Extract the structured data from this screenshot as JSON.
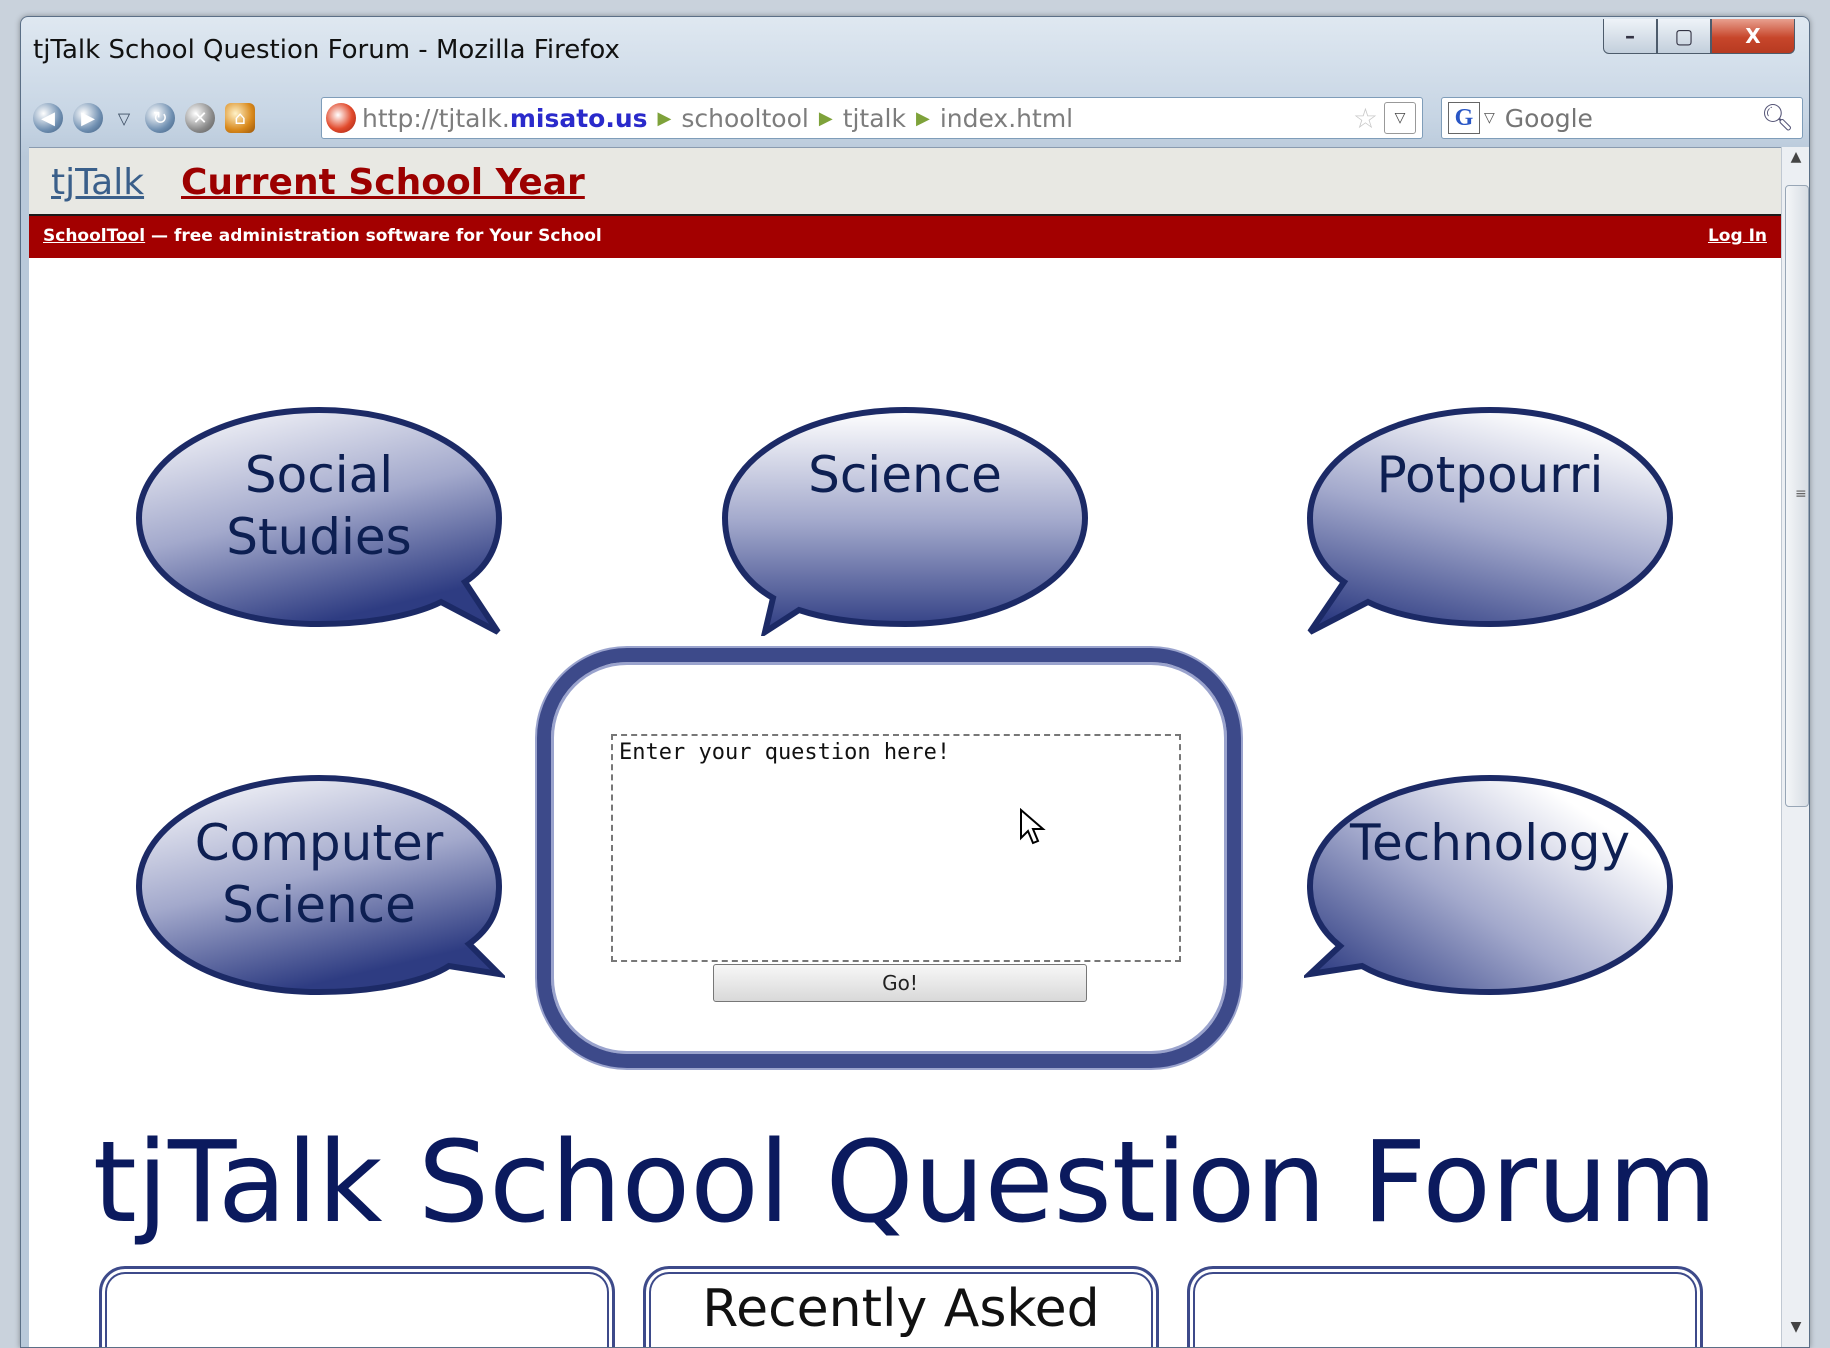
{
  "window": {
    "title": "tjTalk School Question Forum - Mozilla Firefox",
    "controls": {
      "minimize": "–",
      "maximize": "▢",
      "close": "X"
    }
  },
  "toolbar": {
    "url_prefix": "http://tjtalk.",
    "url_domain": "misato.us",
    "crumbs": [
      "schooltool",
      "tjtalk",
      "index.html"
    ],
    "search_placeholder": "Google"
  },
  "header": {
    "brand": "tjTalk",
    "current_year": "Current School Year",
    "banner_link": "SchoolTool",
    "banner_text": " — free administration software for Your School",
    "login": "Log In"
  },
  "bubbles": [
    {
      "id": "social-studies",
      "lines": [
        "Social",
        "Studies"
      ]
    },
    {
      "id": "science",
      "lines": [
        "Science",
        ""
      ]
    },
    {
      "id": "potpourri",
      "lines": [
        "Potpourri",
        ""
      ]
    },
    {
      "id": "computer-science",
      "lines": [
        "Computer",
        "Science"
      ]
    },
    {
      "id": "technology",
      "lines": [
        "Technology",
        ""
      ]
    }
  ],
  "question": {
    "placeholder_text": "Enter your question here!",
    "submit_label": "Go!"
  },
  "page_title": "tjTalk School Question Forum",
  "panels": [
    "",
    "Recently Asked",
    ""
  ],
  "colors": {
    "bubble_border": "#1c2a66",
    "bubble_fill_dark": "#2e3c82",
    "header_red": "#a30000",
    "title_blue": "#0b1a5e"
  }
}
